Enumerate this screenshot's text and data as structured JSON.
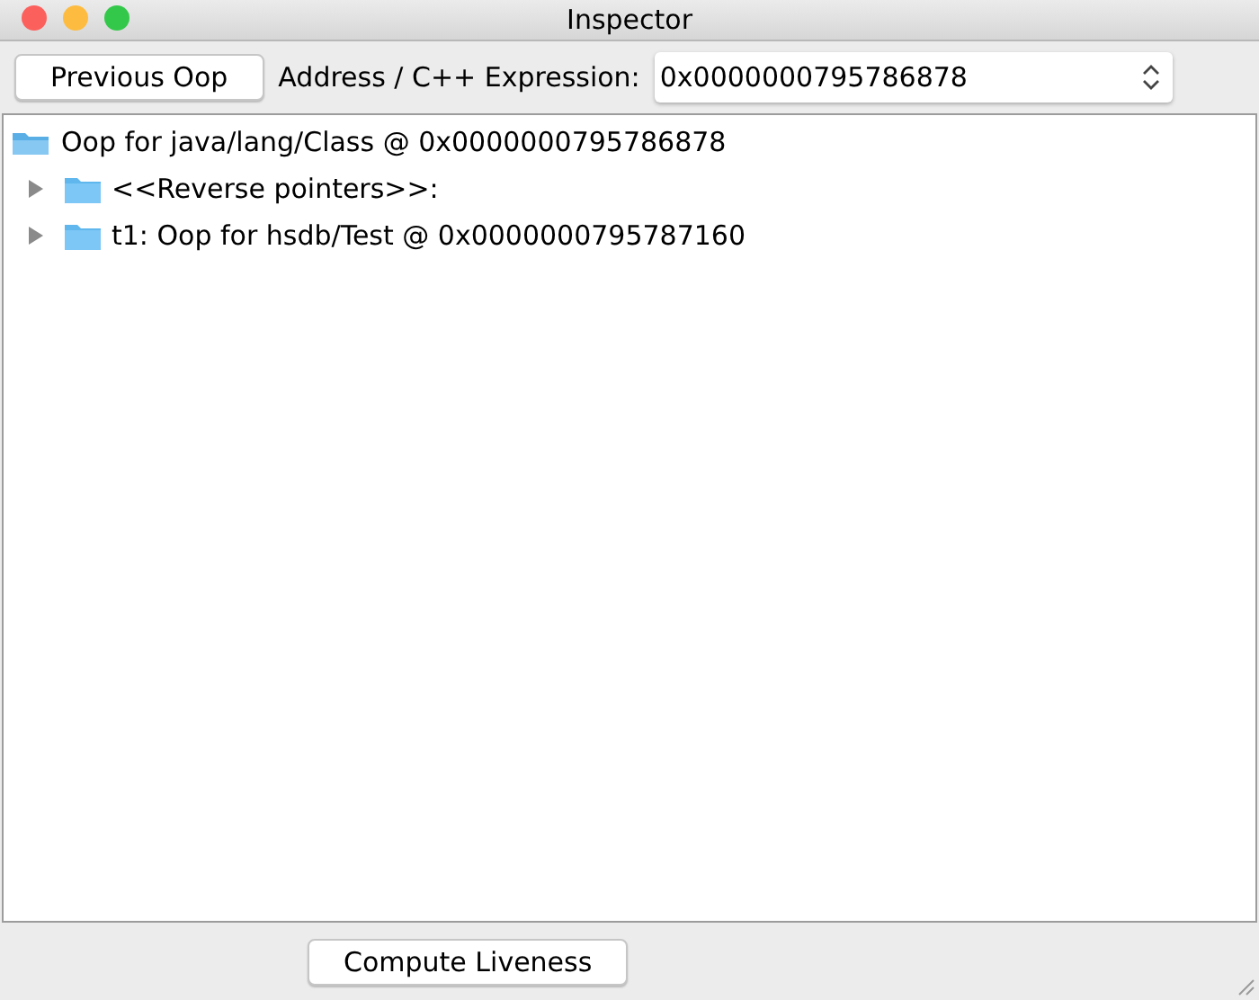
{
  "window": {
    "title": "Inspector"
  },
  "toolbar": {
    "previous_button": "Previous Oop",
    "address_label": "Address / C++ Expression:",
    "address_field": {
      "value": "0x0000000795786878"
    }
  },
  "tree": {
    "label": "Oop for java/lang/Class @ 0x0000000795786878",
    "expanded": true,
    "children": [
      {
        "label": "<<Reverse pointers>>:",
        "expanded": false
      },
      {
        "label": "t1: Oop for hsdb/Test @ 0x0000000795787160",
        "expanded": false
      }
    ]
  },
  "bottom_button": "Compute Liveness"
}
